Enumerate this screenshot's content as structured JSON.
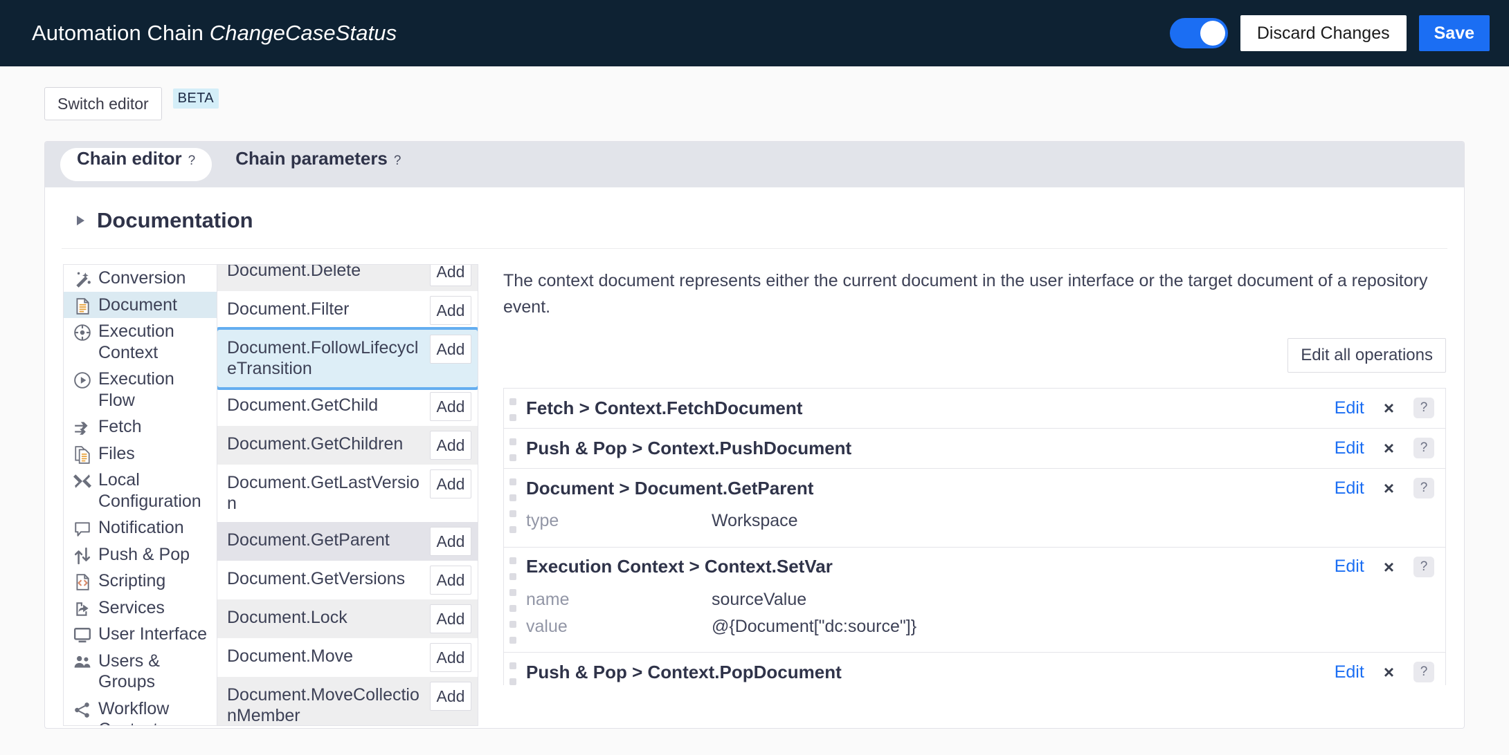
{
  "topbar": {
    "title_prefix": "Automation Chain ",
    "chain_name": "ChangeCaseStatus",
    "discard_label": "Discard Changes",
    "save_label": "Save",
    "toggle_on": true,
    "accent": "#1b6ef3",
    "background": "#0e2233"
  },
  "toolbar": {
    "switch_editor_label": "Switch editor",
    "beta_label": "BETA"
  },
  "tabs": [
    {
      "label": "Chain editor",
      "help": "?",
      "active": true
    },
    {
      "label": "Chain parameters",
      "help": "?",
      "active": false
    }
  ],
  "documentation": {
    "title": "Documentation",
    "expanded": false
  },
  "categories": [
    {
      "label": "Conversion",
      "icon": "wand-icon",
      "selected": false
    },
    {
      "label": "Document",
      "icon": "document-icon",
      "selected": true
    },
    {
      "label": "Execution Context",
      "icon": "gear-circle-icon",
      "selected": false
    },
    {
      "label": "Execution Flow",
      "icon": "play-circle-icon",
      "selected": false
    },
    {
      "label": "Fetch",
      "icon": "arrows-right-icon",
      "selected": false
    },
    {
      "label": "Files",
      "icon": "files-icon",
      "selected": false
    },
    {
      "label": "Local Configuration",
      "icon": "tools-icon",
      "selected": false
    },
    {
      "label": "Notification",
      "icon": "speech-bubble-icon",
      "selected": false
    },
    {
      "label": "Push & Pop",
      "icon": "push-pop-arrows-icon",
      "selected": false
    },
    {
      "label": "Scripting",
      "icon": "code-document-icon",
      "selected": false
    },
    {
      "label": "Services",
      "icon": "share-document-icon",
      "selected": false
    },
    {
      "label": "User Interface",
      "icon": "monitor-icon",
      "selected": false
    },
    {
      "label": "Users & Groups",
      "icon": "users-icon",
      "selected": false
    },
    {
      "label": "Workflow Context",
      "icon": "network-share-icon",
      "selected": false
    }
  ],
  "operations": {
    "add_label": "Add",
    "items": [
      {
        "name": "Document.Delete",
        "stripe": true,
        "focus": false,
        "hover": false,
        "clipped_top": true
      },
      {
        "name": "Document.Filter",
        "stripe": false,
        "focus": false,
        "hover": false
      },
      {
        "name": "Document.FollowLifecycleTransition",
        "stripe": false,
        "focus": true,
        "hover": false
      },
      {
        "name": "Document.GetChild",
        "stripe": false,
        "focus": false,
        "hover": false
      },
      {
        "name": "Document.GetChildren",
        "stripe": true,
        "focus": false,
        "hover": false
      },
      {
        "name": "Document.GetLastVersion",
        "stripe": false,
        "focus": false,
        "hover": false
      },
      {
        "name": "Document.GetParent",
        "stripe": true,
        "focus": false,
        "hover": true
      },
      {
        "name": "Document.GetVersions",
        "stripe": false,
        "focus": false,
        "hover": false
      },
      {
        "name": "Document.Lock",
        "stripe": true,
        "focus": false,
        "hover": false
      },
      {
        "name": "Document.Move",
        "stripe": false,
        "focus": false,
        "hover": false
      },
      {
        "name": "Document.MoveCollectionMember",
        "stripe": true,
        "focus": false,
        "hover": false,
        "clipped_bottom": true
      }
    ]
  },
  "detail": {
    "description": "The context document represents either the current document in the user interface or the target document of a repository event.",
    "edit_all_label": "Edit all operations",
    "edit_label": "Edit",
    "remove_label": "×",
    "help_label": "?",
    "chain_operations": [
      {
        "title": "Fetch > Context.FetchDocument",
        "params": []
      },
      {
        "title": "Push & Pop > Context.PushDocument",
        "params": []
      },
      {
        "title": "Document > Document.GetParent",
        "params": [
          {
            "key": "type",
            "value": "Workspace"
          }
        ]
      },
      {
        "title": "Execution Context > Context.SetVar",
        "params": [
          {
            "key": "name",
            "value": "sourceValue"
          },
          {
            "key": "value",
            "value": "@{Document[\"dc:source\"]}"
          }
        ]
      },
      {
        "title": "Push & Pop > Context.PopDocument",
        "params": []
      }
    ]
  }
}
